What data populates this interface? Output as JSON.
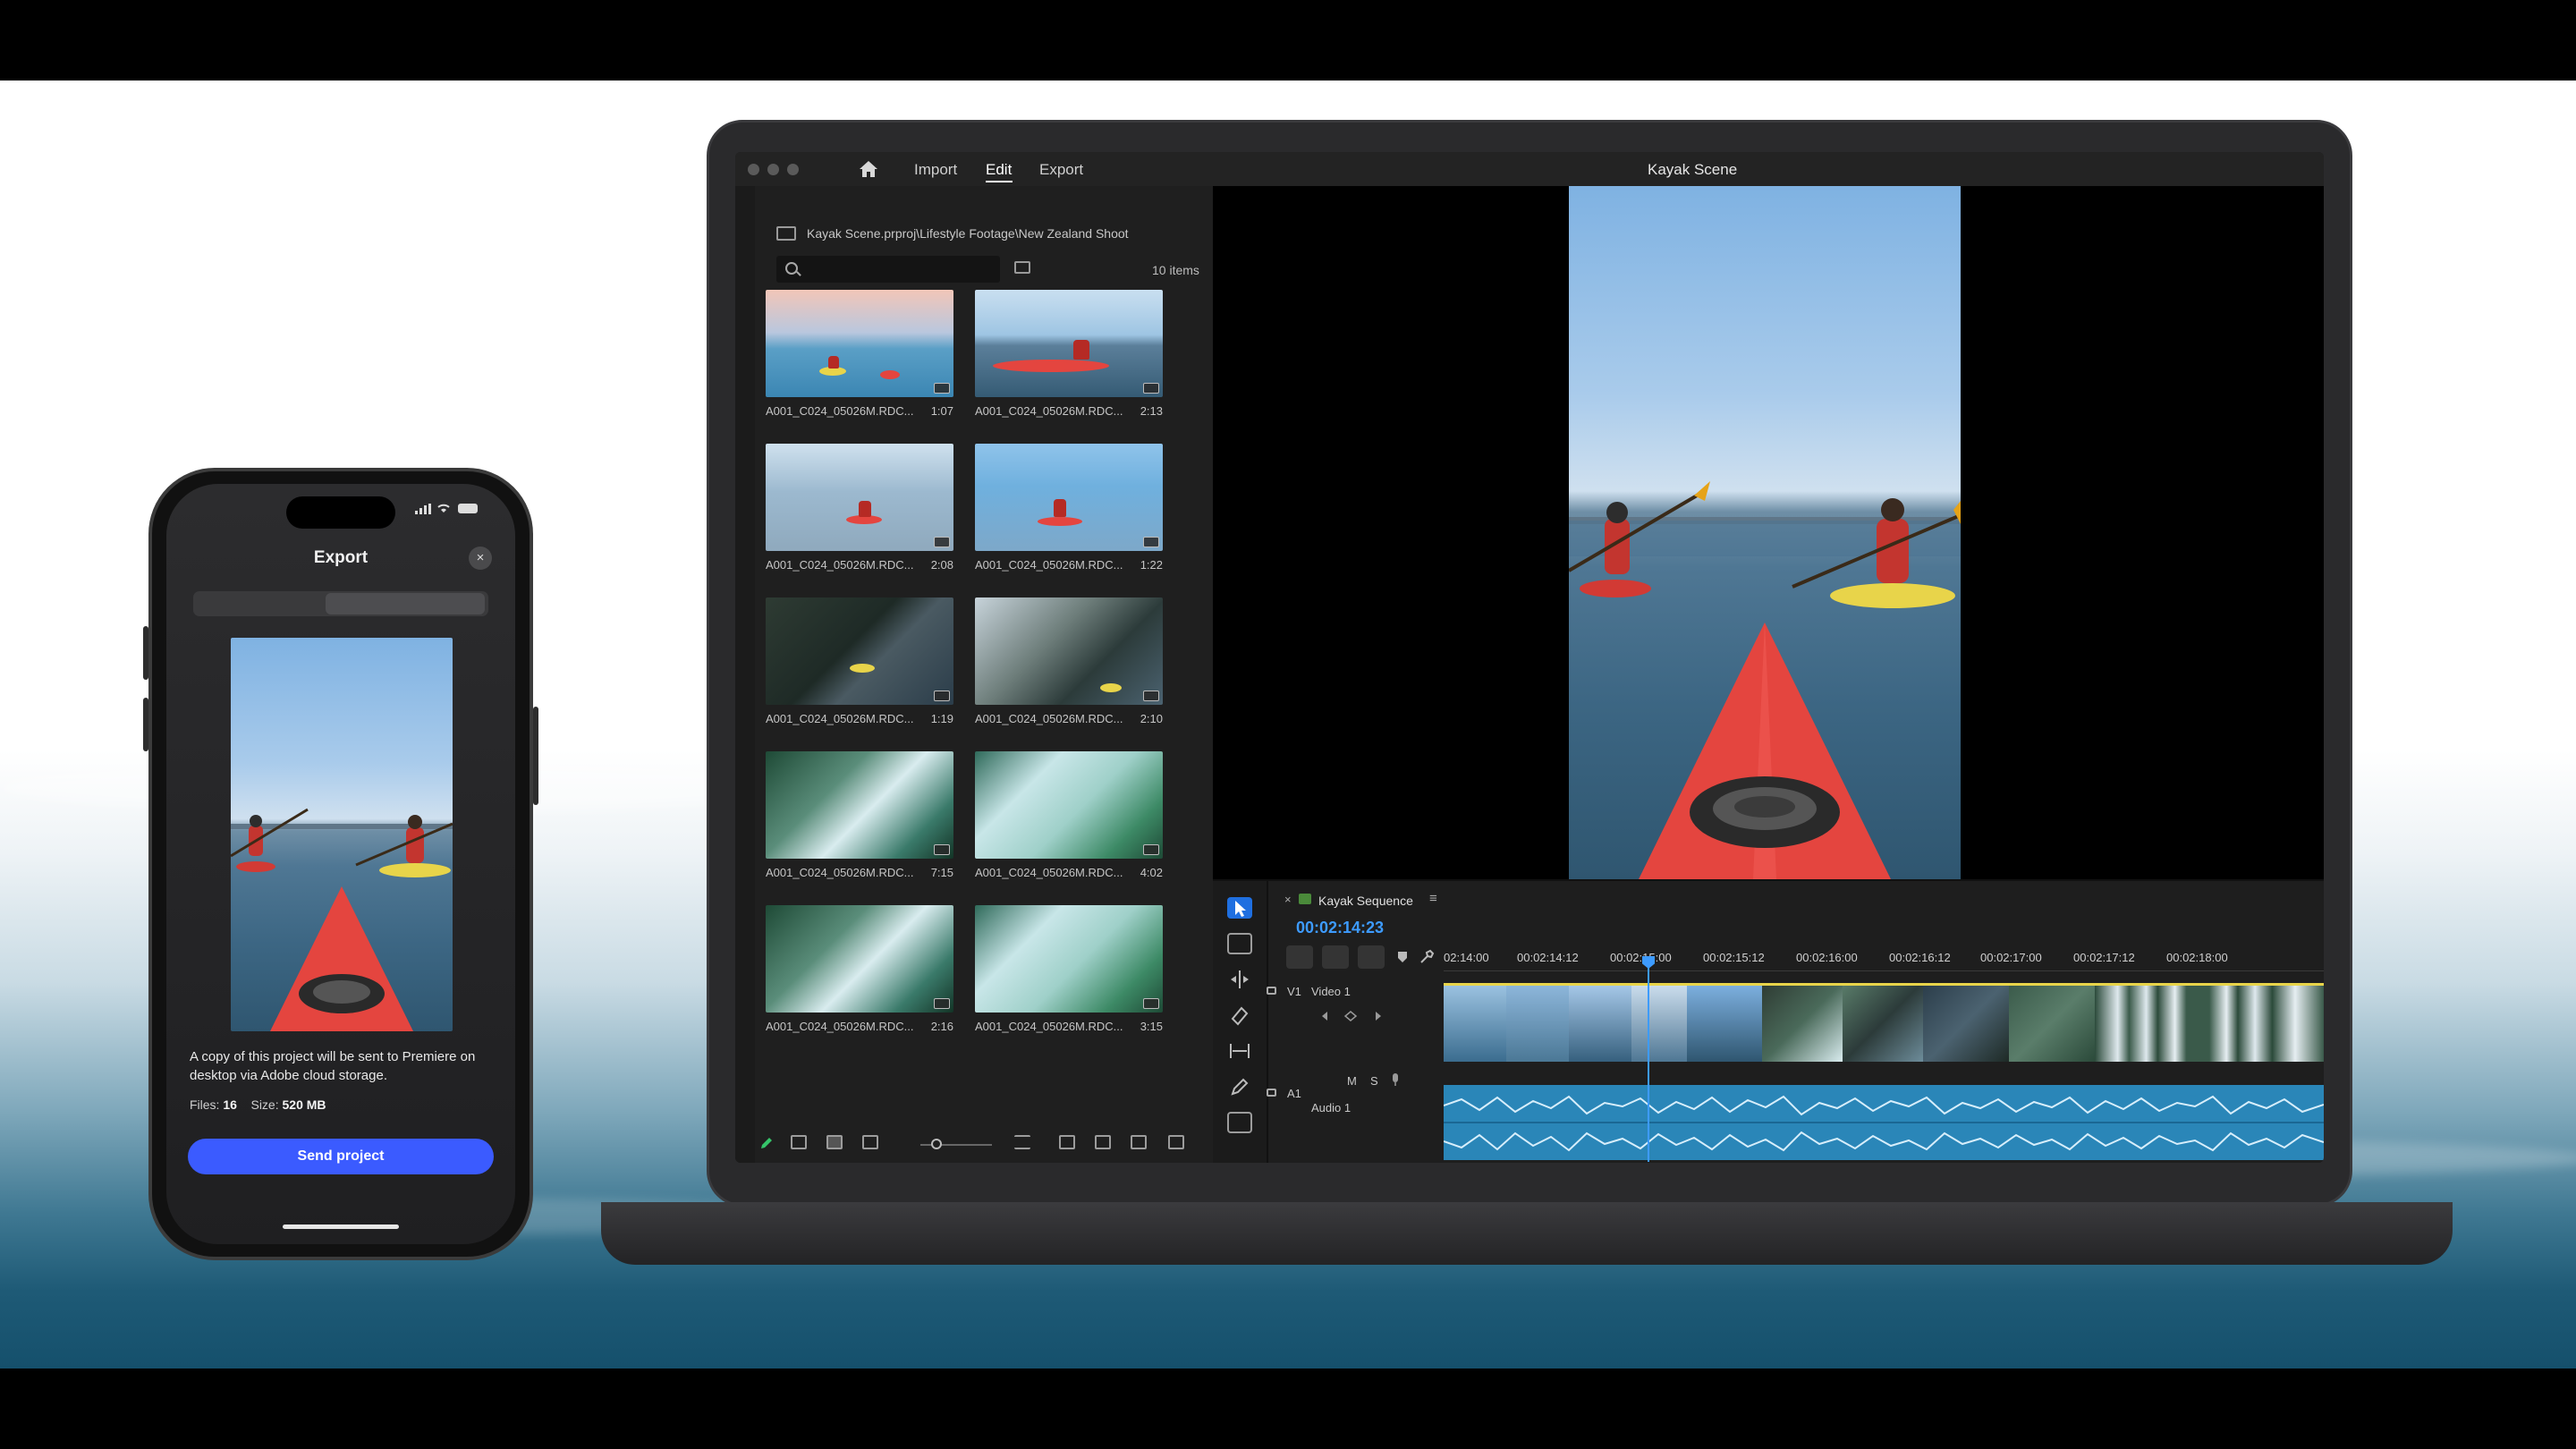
{
  "laptop_app": {
    "nav": {
      "import": "Import",
      "edit": "Edit",
      "export": "Export"
    },
    "title": "Kayak Scene",
    "media_panel": {
      "breadcrumb": "Kayak Scene.prproj\\Lifestyle Footage\\New Zealand Shoot",
      "items_count": "10 items",
      "clips": [
        {
          "name": "A001_C024_05026M.RDC...",
          "duration": "1:07"
        },
        {
          "name": "A001_C024_05026M.RDC...",
          "duration": "2:13"
        },
        {
          "name": "A001_C024_05026M.RDC...",
          "duration": "2:08"
        },
        {
          "name": "A001_C024_05026M.RDC...",
          "duration": "1:22"
        },
        {
          "name": "A001_C024_05026M.RDC...",
          "duration": "1:19"
        },
        {
          "name": "A001_C024_05026M.RDC...",
          "duration": "2:10"
        },
        {
          "name": "A001_C024_05026M.RDC...",
          "duration": "7:15"
        },
        {
          "name": "A001_C024_05026M.RDC...",
          "duration": "4:02"
        },
        {
          "name": "A001_C024_05026M.RDC...",
          "duration": "2:16"
        },
        {
          "name": "A001_C024_05026M.RDC...",
          "duration": "3:15"
        }
      ]
    },
    "timeline": {
      "sequence_name": "Kayak Sequence",
      "close_glyph": "×",
      "menu_glyph": "≡",
      "timecode": "00:02:14:23",
      "ruler": [
        "02:14:00",
        "00:02:14:12",
        "00:02:15:00",
        "00:02:15:12",
        "00:02:16:00",
        "00:02:16:12",
        "00:02:17:00",
        "00:02:17:12",
        "00:02:18:00"
      ],
      "video_track_id": "V1",
      "video_track_name": "Video 1",
      "audio_track_id": "A1",
      "audio_track_name": "Audio 1",
      "audio_m": "M",
      "audio_s": "S"
    }
  },
  "phone_app": {
    "title": "Export",
    "close_glyph": "×",
    "note": "A copy of this project will be sent to Premiere on desktop via Adobe cloud storage.",
    "files_label": "Files:",
    "files_value": "16",
    "size_label": "Size:",
    "size_value": "520 MB",
    "send_button": "Send project"
  },
  "colors": {
    "accent_blue": "#3d9bff",
    "send_button": "#3b5bff",
    "kayak_red": "#e4453f",
    "audio_track": "#2a86b8",
    "clip_yellow": "#e8d44a"
  },
  "icons": [
    "home-icon",
    "search-icon",
    "bin-icon",
    "close-icon",
    "selection-tool-icon",
    "track-select-icon",
    "ripple-edit-icon",
    "razor-icon",
    "slip-icon",
    "pen-icon",
    "text-icon",
    "lock-icon",
    "wifi-icon",
    "battery-icon"
  ]
}
